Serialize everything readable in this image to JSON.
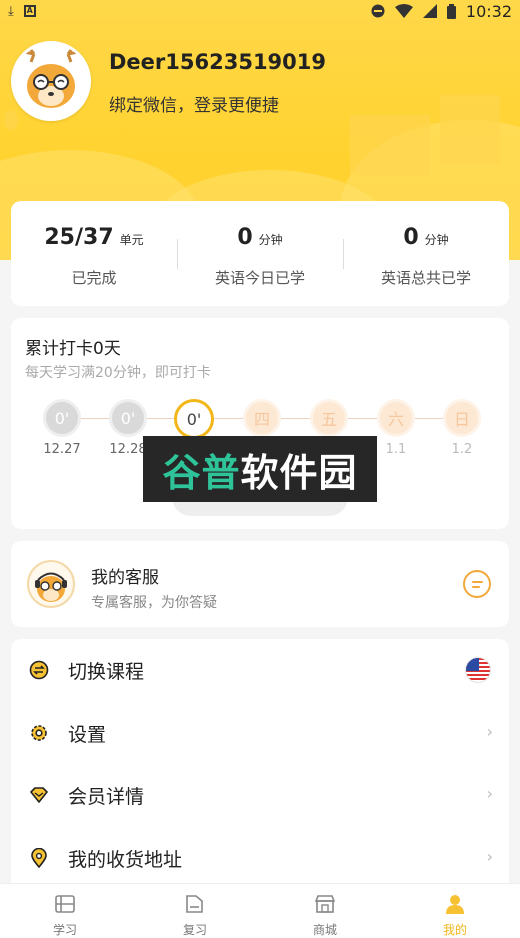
{
  "status_bar": {
    "time": "10:32",
    "left_icons": [
      "download-icon",
      "app-notification-icon"
    ],
    "right_icons": [
      "do-not-disturb-icon",
      "wifi-icon",
      "signal-icon",
      "battery-icon"
    ]
  },
  "profile": {
    "username": "Deer15623519019",
    "bind_wechat": "绑定微信，登录更便捷"
  },
  "stats": [
    {
      "value": "25/37",
      "unit": "单元",
      "label": "已完成"
    },
    {
      "value": "0",
      "unit": "分钟",
      "label": "英语今日已学"
    },
    {
      "value": "0",
      "unit": "分钟",
      "label": "英语总共已学"
    }
  ],
  "checkin": {
    "title": "累计打卡0天",
    "subtitle": "每天学习满20分钟，即可打卡",
    "days": [
      {
        "mark": "0'",
        "date": "12.27",
        "state": "past"
      },
      {
        "mark": "0'",
        "date": "12.28",
        "state": "past"
      },
      {
        "mark": "0'",
        "date": "",
        "state": "today"
      },
      {
        "mark": "四",
        "date": "",
        "state": "future"
      },
      {
        "mark": "五",
        "date": "",
        "state": "future"
      },
      {
        "mark": "六",
        "date": "1.1",
        "state": "future"
      },
      {
        "mark": "日",
        "date": "1.2",
        "state": "future"
      }
    ]
  },
  "watermark": {
    "part1": "谷普",
    "part2": "软件园"
  },
  "service": {
    "title": "我的客服",
    "subtitle": "专属客服，为你答疑"
  },
  "menu": [
    {
      "label": "切换课程",
      "icon": "switch-course-icon",
      "trailing": "us-flag-icon"
    },
    {
      "label": "设置",
      "icon": "settings-gear-icon",
      "trailing": "chevron-right-icon"
    },
    {
      "label": "会员详情",
      "icon": "diamond-icon",
      "trailing": "chevron-right-icon"
    },
    {
      "label": "我的收货地址",
      "icon": "location-pin-icon",
      "trailing": "chevron-right-icon"
    }
  ],
  "tabs": [
    {
      "label": "学习",
      "icon": "study-icon",
      "active": false
    },
    {
      "label": "复习",
      "icon": "review-folder-icon",
      "active": false
    },
    {
      "label": "商城",
      "icon": "store-icon",
      "active": false
    },
    {
      "label": "我的",
      "icon": "profile-person-icon",
      "active": true
    }
  ],
  "colors": {
    "header_yellow": "#ffd331",
    "accent": "#f2b619",
    "chat_orange": "#f2a93b"
  }
}
